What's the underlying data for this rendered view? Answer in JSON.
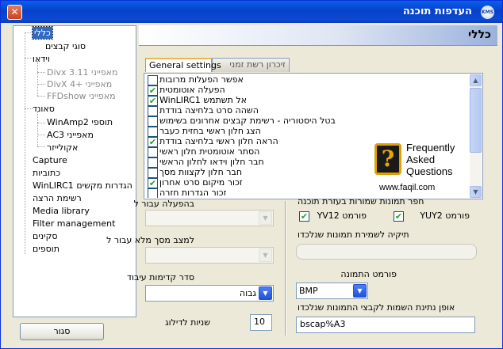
{
  "window": {
    "title": "העדפות תוכנה",
    "close_label": "✕",
    "icon_label": "KMS"
  },
  "tree": {
    "items": [
      {
        "label": "כללי",
        "dim": false,
        "sel": true
      },
      {
        "label": "סוגי קבצים",
        "dim": false,
        "sel": false
      },
      {
        "label": "וידאו",
        "dim": false,
        "sel": false
      },
      {
        "label": "Divx 3.11 מאפייני",
        "dim": true,
        "sel": false
      },
      {
        "label": "DivX 4+ מאפייני",
        "dim": true,
        "sel": false
      },
      {
        "label": "FFDshow מאפייני",
        "dim": true,
        "sel": false
      },
      {
        "label": "סאונד",
        "dim": false,
        "sel": false
      },
      {
        "label": "WinAmp2 תוספי",
        "dim": false,
        "sel": false
      },
      {
        "label": "AC3 מאפייני",
        "dim": false,
        "sel": false
      },
      {
        "label": "אקולייזר",
        "dim": false,
        "sel": false
      },
      {
        "label": "Capture",
        "dim": false,
        "sel": false
      },
      {
        "label": "כתוביות",
        "dim": false,
        "sel": false
      },
      {
        "label": "WinLIRC1 הגדרות מקשים",
        "dim": false,
        "sel": false
      },
      {
        "label": "רשימת הרצה",
        "dim": false,
        "sel": false
      },
      {
        "label": "Media library",
        "dim": false,
        "sel": false
      },
      {
        "label": "Filter management",
        "dim": false,
        "sel": false
      },
      {
        "label": "סקינים",
        "dim": false,
        "sel": false
      },
      {
        "label": "תוספים",
        "dim": false,
        "sel": false
      }
    ]
  },
  "close_button": "סגור",
  "header": {
    "title": "כללי"
  },
  "tabs": [
    {
      "label": "General settings"
    },
    {
      "label": "זיכרון רשת זמני"
    }
  ],
  "checklist": [
    {
      "label": "אפשר הפעלות מרובות",
      "checked": false
    },
    {
      "label": "הפעלה אוטומטית",
      "checked": true
    },
    {
      "label": "WinLIRC1 אל תשתמש",
      "checked": true
    },
    {
      "label": "השהה סרט בלחיצה בודדת",
      "checked": false
    },
    {
      "label": "בטל היסטוריה - רשימת קבצים אחרונים בשימוש",
      "checked": false
    },
    {
      "label": "הצג חלון ראשי בחזית כעבר",
      "checked": false
    },
    {
      "label": "הראה חלון ראשי בלחיצה בודדת",
      "checked": true
    },
    {
      "label": "הסתר אוטומטית חלון ראשי",
      "checked": false
    },
    {
      "label": "חבר חלון וידאו לחלון הראשי",
      "checked": false
    },
    {
      "label": "חבר חלון לקצוות מסך",
      "checked": false
    },
    {
      "label": "זכור מיקום סרט אחרון",
      "checked": true
    },
    {
      "label": "זכור הגדרות חזרה",
      "checked": false
    }
  ],
  "faq": {
    "line1": "Frequently",
    "line2": "Asked",
    "line3": "Questions",
    "url": "www.faqil.com",
    "glyph": "?"
  },
  "left_controls": {
    "on_play_label": "בהפעלה עבור ל",
    "fullscreen_label": "למצב מסך מלא עבור ל",
    "priority_label": "סדר קדימות עיבוד",
    "priority_value": "גבוה",
    "skip_label": "שניות לדילוג",
    "skip_value": "10"
  },
  "right_controls": {
    "save_frames_label": "חפר תמונות שמורות בעזרת תוכנה",
    "yv12_label": "פורמט YV12",
    "yv12_checked": true,
    "yuy2_label": "פורמט YUY2",
    "yuy2_checked": true,
    "folder_label": "תיקיה לשמירת תמונות שנלכדו",
    "format_label": "פורמט התמונה",
    "format_value": "BMP",
    "naming_label": "אופן נתינת השמות לקבצי התמונות שנלכדו",
    "naming_value": "bscap%A3"
  },
  "icons": {
    "check": "✔",
    "arrow_down": "▼",
    "arrow_up": "▲"
  }
}
